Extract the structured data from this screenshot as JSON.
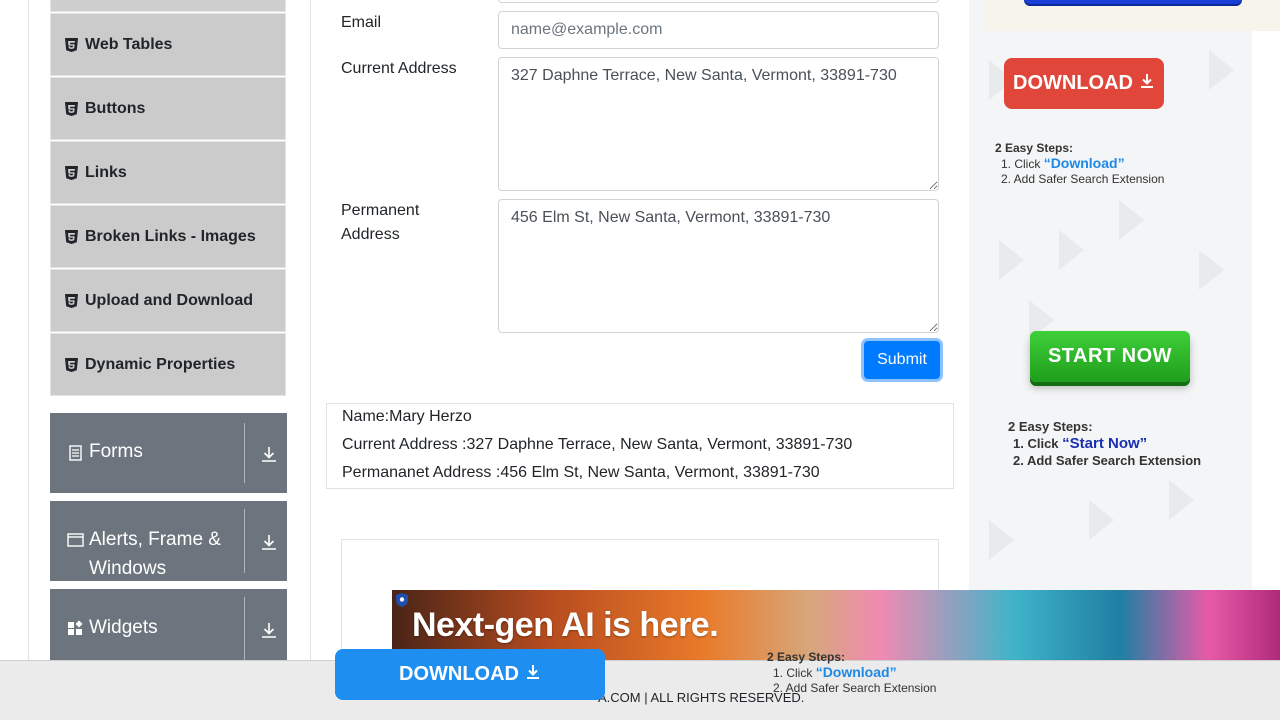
{
  "sidebar": {
    "items": [
      {
        "label": "Web Tables"
      },
      {
        "label": "Buttons"
      },
      {
        "label": "Links"
      },
      {
        "label": "Broken Links - Images"
      },
      {
        "label": "Upload and Download"
      },
      {
        "label": "Dynamic Properties"
      }
    ],
    "groups": [
      {
        "label": "Forms",
        "icon": "form-icon"
      },
      {
        "label": "Alerts, Frame &",
        "label_line2": "Windows",
        "icon": "window-icon"
      },
      {
        "label": "Widgets",
        "icon": "widgets-icon"
      }
    ]
  },
  "form": {
    "email_label": "Email",
    "email_placeholder": "name@example.com",
    "email_value": "",
    "current_address_label": "Current Address",
    "current_address_value": "327 Daphne Terrace, New Santa, Vermont, 33891-730",
    "permanent_address_label_line1": "Permanent",
    "permanent_address_label_line2": "Address",
    "permanent_address_value": "456 Elm St, New Santa, Vermont, 33891-730",
    "submit_label": "Submit"
  },
  "output": {
    "name": "Name:Mary Herzo",
    "current_address": "Current Address :327 Daphne Terrace, New Santa, Vermont, 33891-730",
    "permanent_address": "Permananet Address :456 Elm St, New Santa, Vermont, 33891-730"
  },
  "ads": {
    "right": {
      "download_label": "DOWNLOAD",
      "steps_title": "2 Easy Steps:",
      "step1_prefix": "1. Click ",
      "step1_highlight": "“Download”",
      "step2": "2. Add Safer Search Extension",
      "start_label": "START NOW",
      "steps2_title": "2 Easy Steps:",
      "steps2_step1_prefix": "1. Click ",
      "steps2_step1_highlight": "“Start Now”",
      "steps2_step2": "2. Add Safer Search Extension"
    },
    "bottom": {
      "headline": "Next-gen AI is here.",
      "download_label": "DOWNLOAD",
      "steps_title": "2 Easy Steps:",
      "step1_prefix": "1. Click ",
      "step1_highlight": "“Download”",
      "step2": "2. Add Safer Search Extension"
    }
  },
  "footer": {
    "text": "A.COM | ALL RIGHTS RESERVED."
  },
  "colors": {
    "menu_item_bg": "#cbcbcb",
    "group_bg": "#6c757d",
    "submit_bg": "#007bff",
    "ad_download_red": "#e0473a",
    "ad_start_green": "#2fb52a",
    "ad_download_blue": "#1e8ef0"
  }
}
